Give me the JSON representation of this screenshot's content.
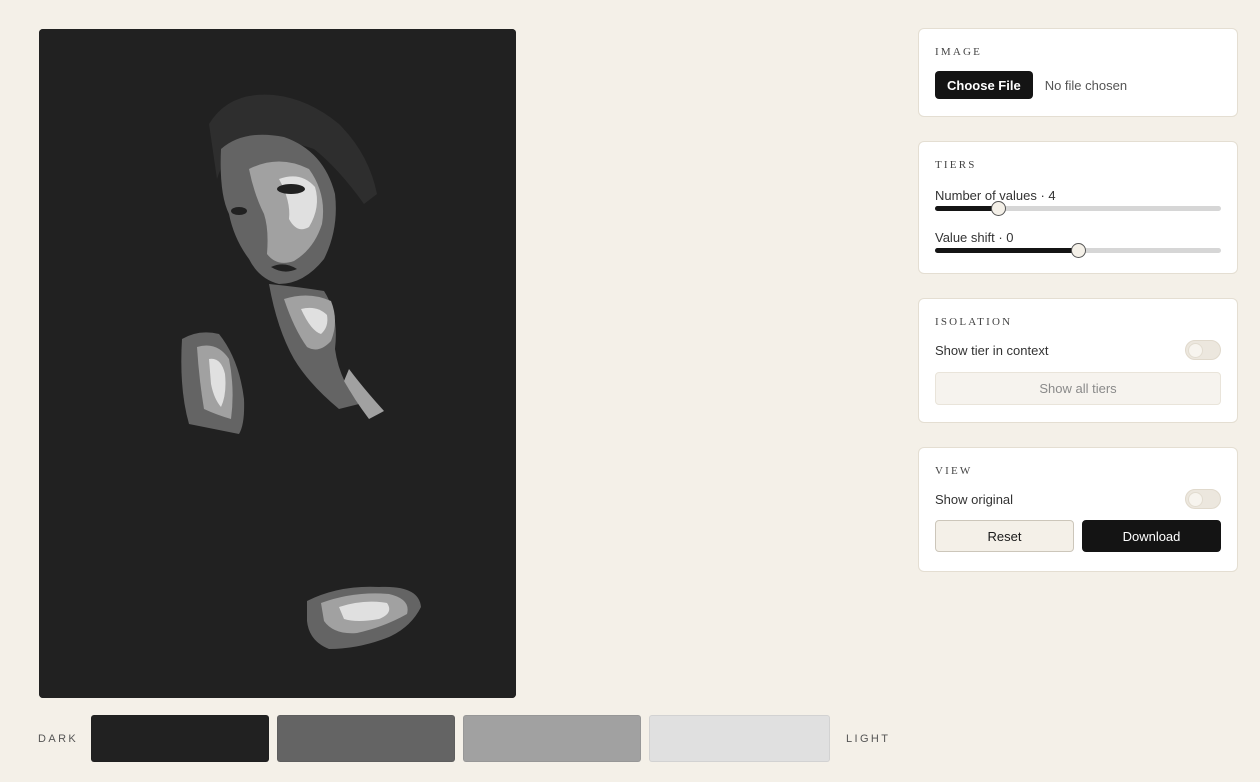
{
  "canvas": {
    "alt": "Posterized portrait of a woman",
    "tier_colors": [
      "#212121",
      "#646464",
      "#a1a1a1",
      "#e0e0e0"
    ]
  },
  "strip": {
    "dark_label": "DARK",
    "light_label": "LIGHT",
    "swatches": [
      {
        "color": "#212121"
      },
      {
        "color": "#646464"
      },
      {
        "color": "#a1a1a1"
      },
      {
        "color": "#e0e0e0"
      }
    ]
  },
  "image_panel": {
    "title": "IMAGE",
    "choose_file_label": "Choose File",
    "file_status": "No file chosen"
  },
  "tiers_panel": {
    "title": "TIERS",
    "number_of_values_label": "Number of values · 4",
    "number_of_values_fraction": 0.22,
    "value_shift_label": "Value shift · 0",
    "value_shift_fraction": 0.5
  },
  "isolation_panel": {
    "title": "ISOLATION",
    "toggle_label": "Show tier in context",
    "toggle_on": false,
    "show_all_label": "Show all tiers"
  },
  "view_panel": {
    "title": "VIEW",
    "toggle_label": "Show original",
    "toggle_on": false,
    "reset_label": "Reset",
    "download_label": "Download"
  }
}
